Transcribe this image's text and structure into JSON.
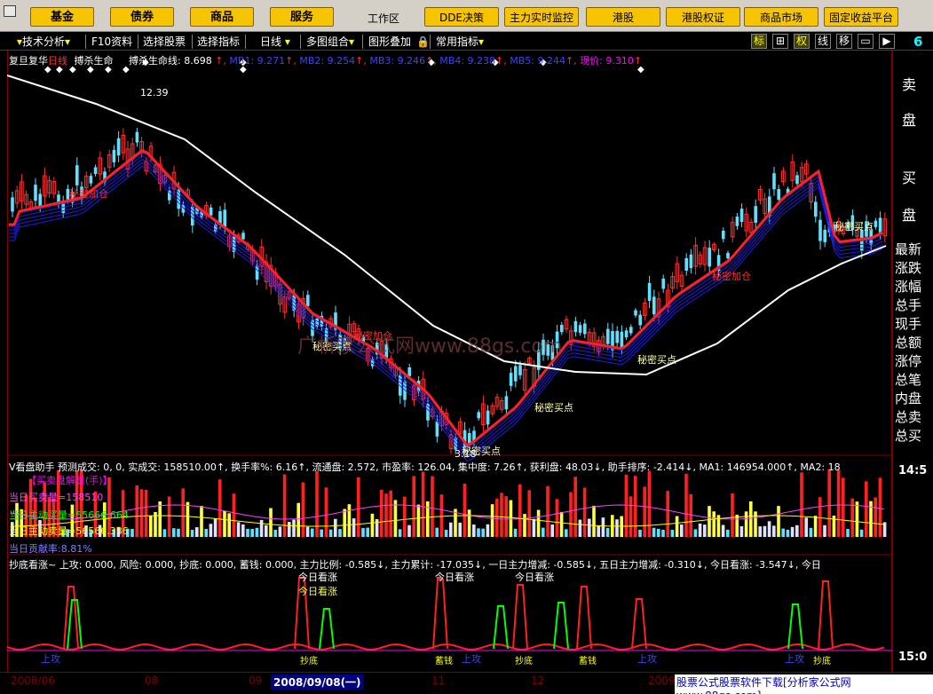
{
  "top_menu": {
    "items": [
      "基金",
      "债券",
      "商品",
      "服务"
    ],
    "workarea_label": "工作区",
    "right_items": [
      "DDE决策",
      "主力实时监控",
      "港股",
      "港股权证",
      "商品市场",
      "固定收益平台"
    ]
  },
  "toolbar": {
    "items": [
      "技术分析",
      "F10资料",
      "选择股票",
      "选择指标",
      "日线",
      "多图组合",
      "图形叠加",
      "常用指标"
    ],
    "right_buttons": [
      "标",
      "⊞",
      "权",
      "线",
      "移",
      "▭",
      "▶"
    ],
    "page_number": "6"
  },
  "main_chart": {
    "header_left": "复旦复华",
    "period": "日线",
    "indicator_name": "搏杀生命",
    "lifeline_label": "搏杀生命线: 8.698",
    "mb_values": [
      "MB1: 9.271",
      "MB2: 9.254",
      "MB3: 9.246",
      "MB4: 9.238",
      "MB5: 9.244"
    ],
    "price_now": "现价: 9.310",
    "high_label": "12.39",
    "low_label": "3.18",
    "signals": [
      "秘密加仓",
      "秘密买点",
      "秘密加仓",
      "秘密买点",
      "秘密买点",
      "秘密买点",
      "秘密加仓",
      "秘密买点"
    ],
    "watermark": "广析家公式网www.88gs.com",
    "colors": {
      "ma_line": "#ff2020",
      "lifeline": "#ffffff",
      "band": "#2020ff",
      "up": "#ff3030",
      "down": "#60e0ff"
    }
  },
  "volume_panel": {
    "header": "V看盘助手 预测成交: 0, 0, 实成交: 158510.00↑, 换手率%: 6.16↑, 流通盘: 2.572, 市盈率: 126.04, 集中度: 7.26↑, 获利盘: 48.03↓, 助手排序: -2.414↓, MA1: 146954.000↑, MA2: 18",
    "sub_header": "【买卖盘解量(手)】",
    "lines": [
      "当日买卖量=158510",
      "当日主动买量=55666.664",
      "当日主动卖量=56566.336"
    ],
    "footer": "当日贡献率:8.81%"
  },
  "bottom_indicator": {
    "header": "抄底看涨~ 上攻: 0.000, 风险: 0.000, 抄底: 0.000, 蓄钱: 0.000, 主力比例: -0.585↓, 主力累计: -17.035↓, 一日主力增减: -0.585↓, 五日主力增减: -0.310↓, 今日看涨: -3.547↓, 今日",
    "label_rise": "今日看涨",
    "label_attack": "上攻",
    "label_bottom": "抄底",
    "label_bottom_alt": "蓄钱"
  },
  "right_panel": {
    "sell": "卖",
    "sell2": "盘",
    "buy": "买",
    "buy2": "盘",
    "items": [
      "最新",
      "涨跌",
      "涨幅",
      "总手",
      "现手",
      "总额",
      "涨停",
      "总笔",
      "内盘",
      "总卖",
      "总买"
    ],
    "time1": "14:5",
    "time2": "15:0"
  },
  "bottom_bar": {
    "labels": [
      "2008/06",
      "08",
      "09"
    ],
    "selected_date": "2008/09/08(一)",
    "labels_after": [
      "11",
      "12",
      "2009"
    ],
    "download_text": "股票公式股票软件下载[分析家公式网www.88gs.com]"
  }
}
